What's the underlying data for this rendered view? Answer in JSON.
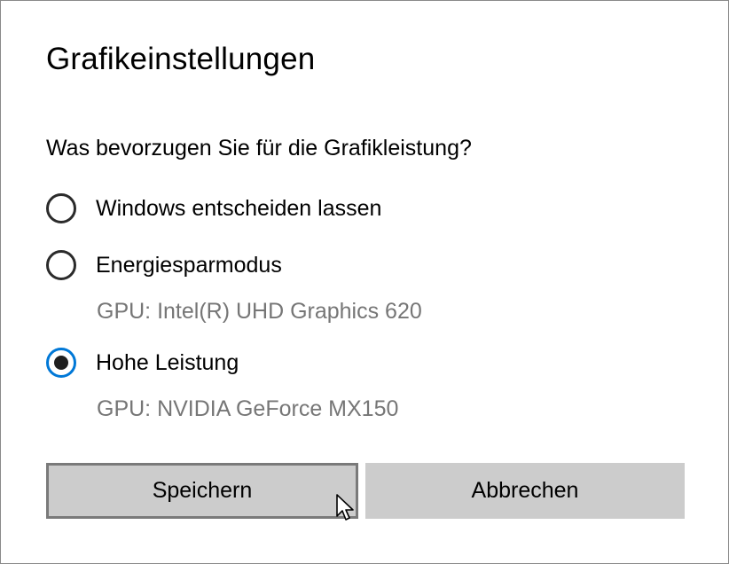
{
  "dialog": {
    "title": "Grafikeinstellungen",
    "question": "Was bevorzugen Sie für die Grafikleistung?",
    "options": [
      {
        "label": "Windows entscheiden lassen",
        "selected": false
      },
      {
        "label": "Energiesparmodus",
        "selected": false,
        "gpu": "GPU: Intel(R) UHD Graphics 620"
      },
      {
        "label": "Hohe Leistung",
        "selected": true,
        "gpu": "GPU: NVIDIA GeForce MX150"
      }
    ],
    "buttons": {
      "save_label": "Speichern",
      "cancel_label": "Abbrechen"
    }
  },
  "colors": {
    "accent": "#0078d7",
    "button_bg": "#cccccc",
    "secondary_text": "#767676"
  },
  "icons": {
    "cursor": "mouse-pointer-icon"
  }
}
